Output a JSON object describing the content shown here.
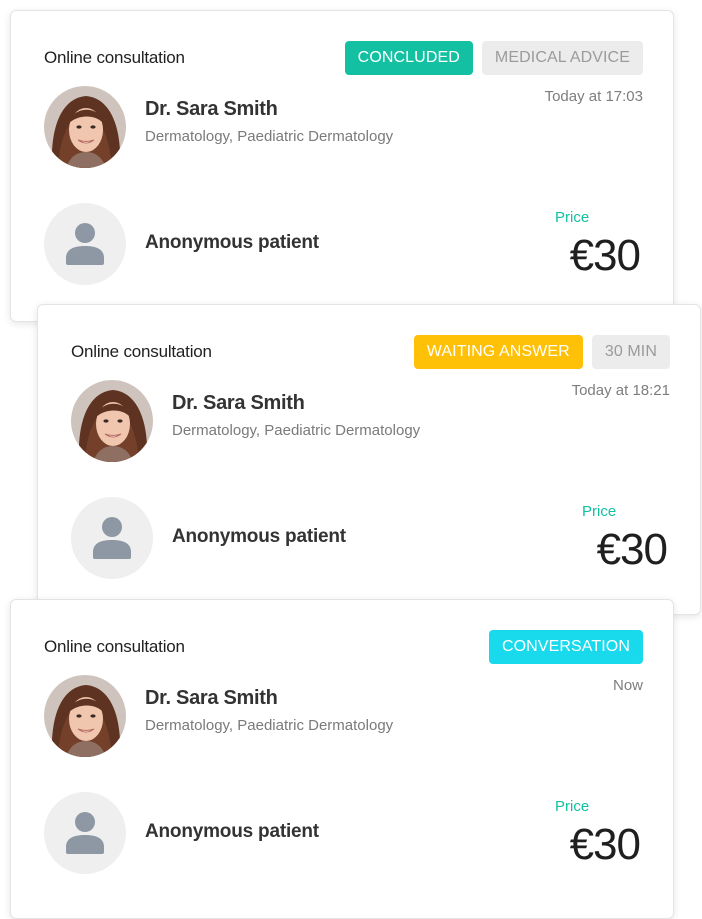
{
  "colors": {
    "concluded": "#13c1a2",
    "waiting": "#ffc107",
    "conversation": "#19d9ed",
    "neutral_badge_bg": "#ececec",
    "neutral_badge_text": "#9b9b9b",
    "price_label": "#13c1a2"
  },
  "icons": {
    "patient_avatar": "person-icon",
    "doctor_avatar": "doctor-photo"
  },
  "cards": [
    {
      "type": "Online consultation",
      "status_badge": "CONCLUDED",
      "secondary_badge": "MEDICAL ADVICE",
      "timestamp": "Today at 17:03",
      "doctor": {
        "name": "Dr. Sara Smith",
        "specialty": "Dermatology, Paediatric Dermatology"
      },
      "patient": {
        "name": "Anonymous patient"
      },
      "price": {
        "label": "Price",
        "value": "€30"
      }
    },
    {
      "type": "Online consultation",
      "status_badge": "WAITING ANSWER",
      "secondary_badge": "30 MIN",
      "timestamp": "Today at 18:21",
      "doctor": {
        "name": "Dr. Sara Smith",
        "specialty": "Dermatology, Paediatric Dermatology"
      },
      "patient": {
        "name": "Anonymous patient"
      },
      "price": {
        "label": "Price",
        "value": "€30"
      }
    },
    {
      "type": "Online consultation",
      "status_badge": "CONVERSATION",
      "timestamp": "Now",
      "doctor": {
        "name": "Dr. Sara Smith",
        "specialty": "Dermatology, Paediatric Dermatology"
      },
      "patient": {
        "name": "Anonymous patient"
      },
      "price": {
        "label": "Price",
        "value": "€30"
      }
    }
  ]
}
